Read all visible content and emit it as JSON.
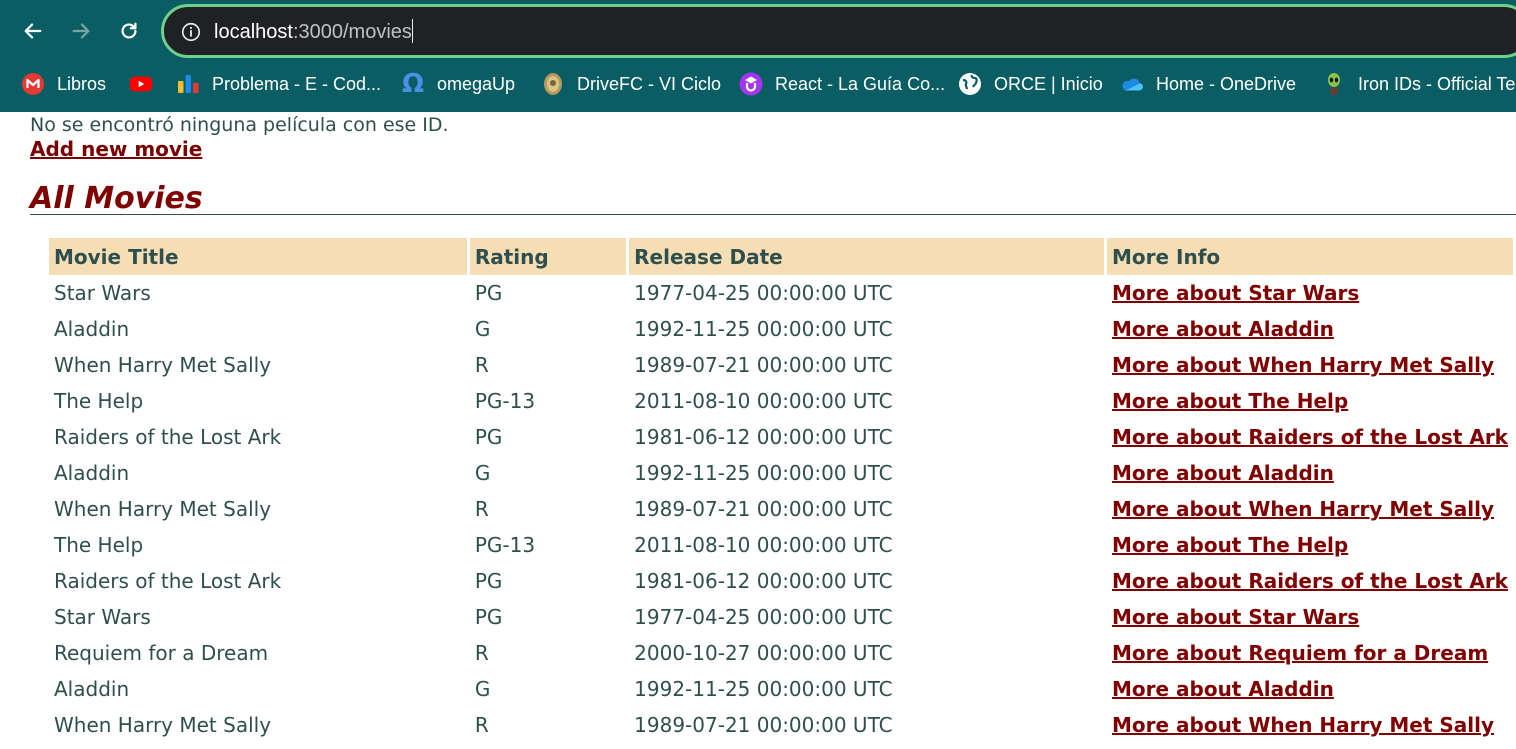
{
  "browser": {
    "url_host": "localhost",
    "url_path": ":3000/movies",
    "bookmarks": [
      {
        "label": "Libros",
        "icon": "m-logo-icon"
      },
      {
        "label": "",
        "icon": "youtube-icon"
      },
      {
        "label": "Problema - E - Cod...",
        "icon": "bar-chart-icon"
      },
      {
        "label": "omegaUp",
        "icon": "omega-icon"
      },
      {
        "label": "DriveFC - VI Ciclo",
        "icon": "seal-icon"
      },
      {
        "label": "React - La Guía Co...",
        "icon": "udemy-icon"
      },
      {
        "label": "ORCE | Inicio",
        "icon": "globe-icon"
      },
      {
        "label": "Home - OneDrive",
        "icon": "cloud-icon"
      },
      {
        "label": "Iron IDs - Official Te...",
        "icon": "alien-icon"
      }
    ]
  },
  "page": {
    "notice": "No se encontró ninguna película con ese ID.",
    "add_link": "Add new movie",
    "heading": "All Movies",
    "columns": [
      "Movie Title",
      "Rating",
      "Release Date",
      "More Info"
    ],
    "rows": [
      {
        "title": "Star Wars",
        "rating": "PG",
        "date": "1977-04-25 00:00:00 UTC",
        "link": "More about Star Wars"
      },
      {
        "title": "Aladdin",
        "rating": "G",
        "date": "1992-11-25 00:00:00 UTC",
        "link": "More about Aladdin"
      },
      {
        "title": "When Harry Met Sally",
        "rating": "R",
        "date": "1989-07-21 00:00:00 UTC",
        "link": "More about When Harry Met Sally"
      },
      {
        "title": "The Help",
        "rating": "PG-13",
        "date": "2011-08-10 00:00:00 UTC",
        "link": "More about The Help"
      },
      {
        "title": "Raiders of the Lost Ark",
        "rating": "PG",
        "date": "1981-06-12 00:00:00 UTC",
        "link": "More about Raiders of the Lost Ark"
      },
      {
        "title": "Aladdin",
        "rating": "G",
        "date": "1992-11-25 00:00:00 UTC",
        "link": "More about Aladdin"
      },
      {
        "title": "When Harry Met Sally",
        "rating": "R",
        "date": "1989-07-21 00:00:00 UTC",
        "link": "More about When Harry Met Sally"
      },
      {
        "title": "The Help",
        "rating": "PG-13",
        "date": "2011-08-10 00:00:00 UTC",
        "link": "More about The Help"
      },
      {
        "title": "Raiders of the Lost Ark",
        "rating": "PG",
        "date": "1981-06-12 00:00:00 UTC",
        "link": "More about Raiders of the Lost Ark"
      },
      {
        "title": "Star Wars",
        "rating": "PG",
        "date": "1977-04-25 00:00:00 UTC",
        "link": "More about Star Wars"
      },
      {
        "title": "Requiem for a Dream",
        "rating": "R",
        "date": "2000-10-27 00:00:00 UTC",
        "link": "More about Requiem for a Dream"
      },
      {
        "title": "Aladdin",
        "rating": "G",
        "date": "1992-11-25 00:00:00 UTC",
        "link": "More about Aladdin"
      },
      {
        "title": "When Harry Met Sally",
        "rating": "R",
        "date": "1989-07-21 00:00:00 UTC",
        "link": "More about When Harry Met Sally"
      }
    ]
  },
  "colors": {
    "chrome_bg": "#0a5e63",
    "header_bg": "#f5deb3",
    "link": "#800000",
    "text": "#2f4f4f"
  }
}
